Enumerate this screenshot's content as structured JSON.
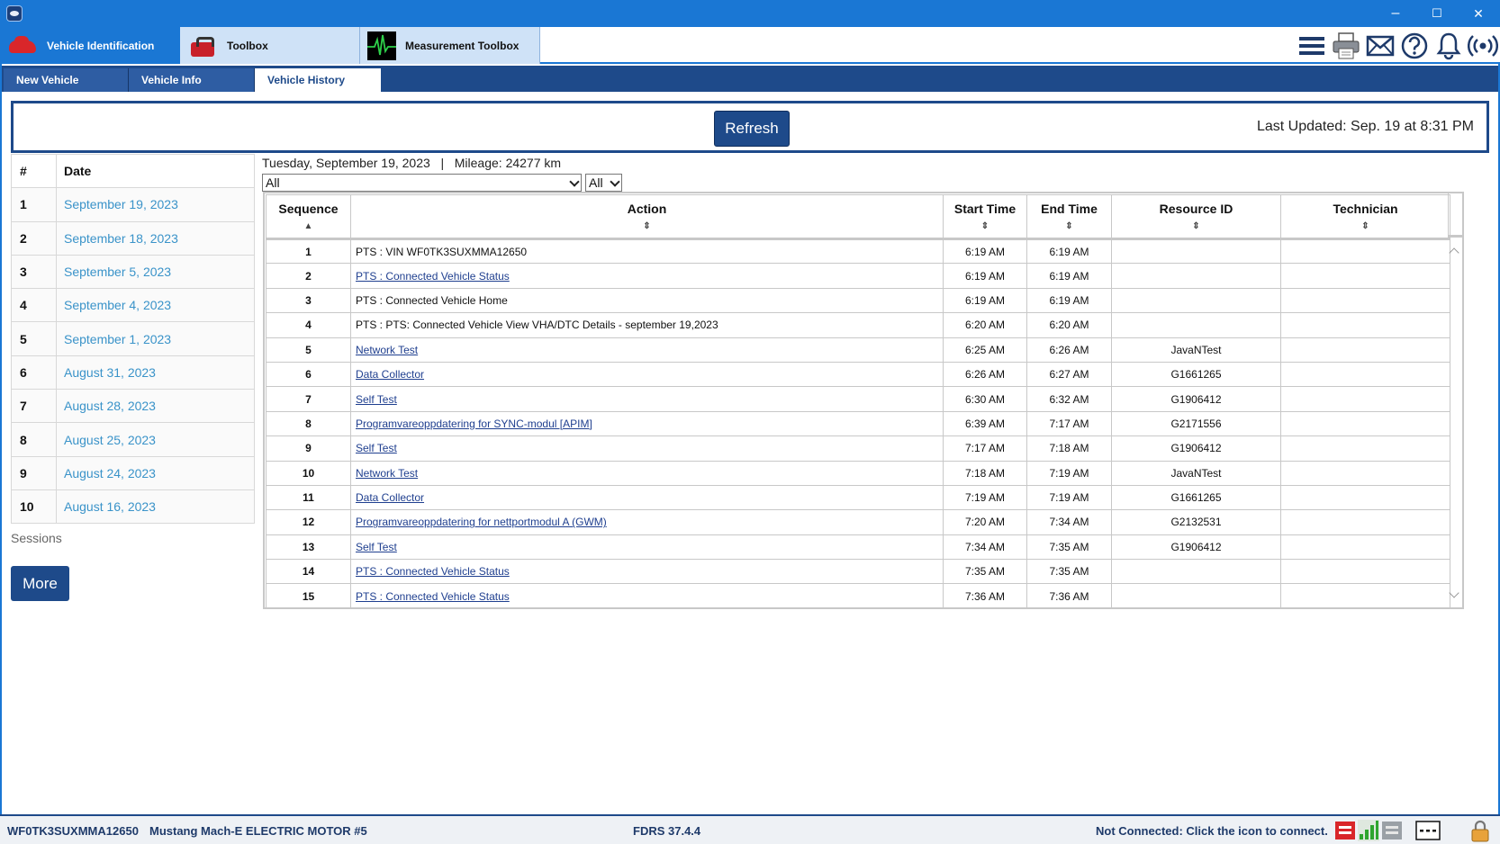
{
  "window": {
    "minimize": "–",
    "maximize": "☐",
    "close": "✕"
  },
  "app_tabs": [
    {
      "label": "Vehicle Identification",
      "icon": "car-icon"
    },
    {
      "label": "Toolbox",
      "icon": "toolbox-icon"
    },
    {
      "label": "Measurement Toolbox",
      "icon": "waveform-icon"
    }
  ],
  "toolbar_icons": [
    "menu-icon",
    "printer-icon",
    "mail-icon",
    "help-icon",
    "bell-icon",
    "wireless-icon"
  ],
  "sub_tabs": [
    {
      "label": "New Vehicle"
    },
    {
      "label": "Vehicle Info"
    },
    {
      "label": "Vehicle History"
    }
  ],
  "refresh": {
    "button_label": "Refresh",
    "last_updated": "Last Updated: Sep. 19 at 8:31 PM"
  },
  "sessions": {
    "headers": {
      "num": "#",
      "date": "Date"
    },
    "rows": [
      {
        "num": "1",
        "date": "September 19, 2023"
      },
      {
        "num": "2",
        "date": "September 18, 2023"
      },
      {
        "num": "3",
        "date": "September 5, 2023"
      },
      {
        "num": "4",
        "date": "September 4, 2023"
      },
      {
        "num": "5",
        "date": "September 1, 2023"
      },
      {
        "num": "6",
        "date": "August 31, 2023"
      },
      {
        "num": "7",
        "date": "August 28, 2023"
      },
      {
        "num": "8",
        "date": "August 25, 2023"
      },
      {
        "num": "9",
        "date": "August 24, 2023"
      },
      {
        "num": "10",
        "date": "August 16, 2023"
      }
    ],
    "label": "Sessions",
    "more_label": "More"
  },
  "session_detail": {
    "header": "Tuesday, September 19, 2023   |   Mileage: 24277 km",
    "filter1": "All",
    "filter2": "All",
    "columns": [
      "Sequence",
      "Action",
      "Start Time",
      "End Time",
      "Resource ID",
      "Technician"
    ],
    "rows": [
      {
        "seq": "1",
        "action": "PTS : VIN WF0TK3SUXMMA12650",
        "link": false,
        "start": "6:19 AM",
        "end": "6:19 AM",
        "resource": "",
        "tech": ""
      },
      {
        "seq": "2",
        "action": "PTS : Connected Vehicle Status",
        "link": true,
        "start": "6:19 AM",
        "end": "6:19 AM",
        "resource": "",
        "tech": ""
      },
      {
        "seq": "3",
        "action": "PTS : Connected Vehicle Home",
        "link": false,
        "start": "6:19 AM",
        "end": "6:19 AM",
        "resource": "",
        "tech": ""
      },
      {
        "seq": "4",
        "action": "PTS : PTS: Connected Vehicle View VHA/DTC Details - september 19,2023",
        "link": false,
        "start": "6:20 AM",
        "end": "6:20 AM",
        "resource": "",
        "tech": ""
      },
      {
        "seq": "5",
        "action": "Network Test",
        "link": true,
        "start": "6:25 AM",
        "end": "6:26 AM",
        "resource": "JavaNTest",
        "tech": ""
      },
      {
        "seq": "6",
        "action": "Data Collector",
        "link": true,
        "start": "6:26 AM",
        "end": "6:27 AM",
        "resource": "G1661265",
        "tech": ""
      },
      {
        "seq": "7",
        "action": "Self Test",
        "link": true,
        "start": "6:30 AM",
        "end": "6:32 AM",
        "resource": "G1906412",
        "tech": ""
      },
      {
        "seq": "8",
        "action": "Programvareoppdatering for SYNC-modul [APIM]",
        "link": true,
        "start": "6:39 AM",
        "end": "7:17 AM",
        "resource": "G2171556",
        "tech": ""
      },
      {
        "seq": "9",
        "action": "Self Test",
        "link": true,
        "start": "7:17 AM",
        "end": "7:18 AM",
        "resource": "G1906412",
        "tech": ""
      },
      {
        "seq": "10",
        "action": "Network Test",
        "link": true,
        "start": "7:18 AM",
        "end": "7:19 AM",
        "resource": "JavaNTest",
        "tech": ""
      },
      {
        "seq": "11",
        "action": "Data Collector",
        "link": true,
        "start": "7:19 AM",
        "end": "7:19 AM",
        "resource": "G1661265",
        "tech": ""
      },
      {
        "seq": "12",
        "action": "Programvareoppdatering for nettportmodul A (GWM)",
        "link": true,
        "start": "7:20 AM",
        "end": "7:34 AM",
        "resource": "G2132531",
        "tech": ""
      },
      {
        "seq": "13",
        "action": "Self Test",
        "link": true,
        "start": "7:34 AM",
        "end": "7:35 AM",
        "resource": "G1906412",
        "tech": ""
      },
      {
        "seq": "14",
        "action": "PTS : Connected Vehicle Status",
        "link": true,
        "start": "7:35 AM",
        "end": "7:35 AM",
        "resource": "",
        "tech": ""
      },
      {
        "seq": "15",
        "action": "PTS : Connected Vehicle Status",
        "link": true,
        "start": "7:36 AM",
        "end": "7:36 AM",
        "resource": "",
        "tech": ""
      }
    ]
  },
  "status_bar": {
    "vin": "WF0TK3SUXMMA12650",
    "model": "Mustang Mach-E ELECTRIC MOTOR #5",
    "version": "FDRS 37.4.4",
    "connection": "Not Connected: Click the icon to connect.",
    "icons": [
      "vci-red-icon",
      "signal-bars-icon",
      "vci-gray-icon",
      "dash-icon",
      "lock-icon"
    ]
  },
  "colors": {
    "title_blue": "#1a77d4",
    "nav_navy": "#1e4a8a",
    "link_blue": "#3a93c9"
  }
}
